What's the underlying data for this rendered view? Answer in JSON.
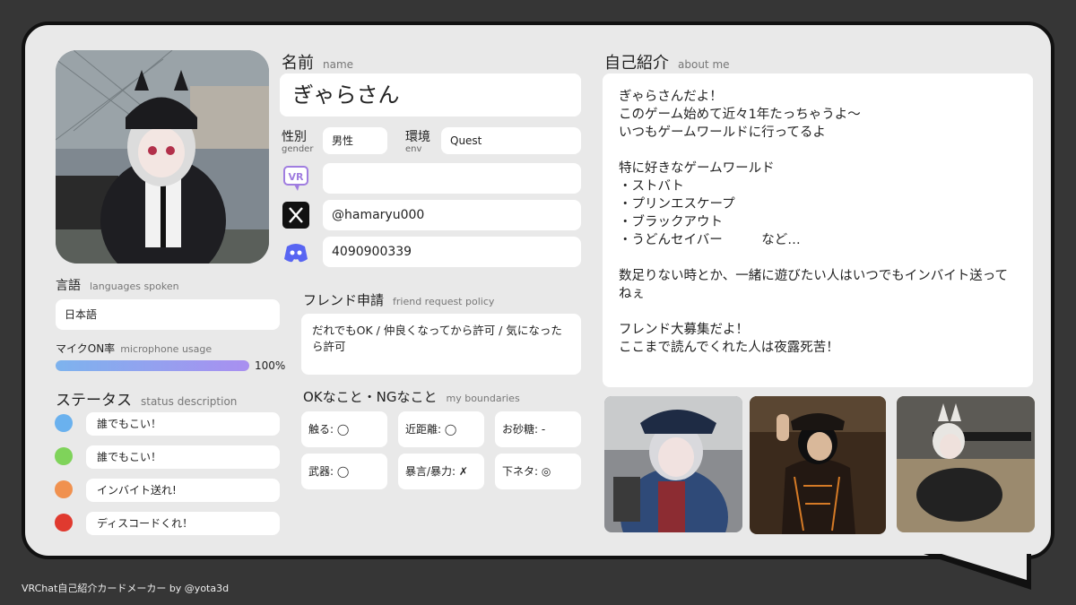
{
  "footer": "VRChat自己紹介カードメーカー by @yota3d",
  "name": {
    "title_jp": "名前",
    "title_en": "name",
    "value": "ぎゃらさん"
  },
  "gender": {
    "label_jp": "性別",
    "label_en": "gender",
    "value": "男性"
  },
  "env": {
    "label_jp": "環境",
    "label_en": "env",
    "value": "Quest"
  },
  "vr_field": {
    "icon": "vr-chat-icon",
    "value": ""
  },
  "x_field": {
    "icon": "x-logo-icon",
    "value": "@hamaryu000"
  },
  "discord_field": {
    "icon": "discord-icon",
    "value": "4090900339"
  },
  "language": {
    "title_jp": "言語",
    "title_en": "languages spoken",
    "value": "日本語"
  },
  "mic": {
    "title_jp": "マイクON率",
    "title_en": "microphone usage",
    "value": "100%",
    "fraction": 1.0
  },
  "status": {
    "title_jp": "ステータス",
    "title_en": "status description",
    "items": [
      {
        "color": "#6ab1ee",
        "text": "誰でもこい！"
      },
      {
        "color": "#7fd35a",
        "text": "誰でもこい！"
      },
      {
        "color": "#f0914f",
        "text": "インバイト送れ!"
      },
      {
        "color": "#e03a2f",
        "text": "ディスコードくれ！"
      }
    ]
  },
  "friend": {
    "title_jp": "フレンド申請",
    "title_en": "friend request policy",
    "value": "だれでもOK / 仲良くなってから許可 / 気になったら許可"
  },
  "boundaries": {
    "title_jp": "OKなこと・NGなこと",
    "title_en": "my boundaries",
    "items": [
      "触る: ◯",
      "近距離: ◯",
      "お砂糖: -",
      "武器: ◯",
      "暴言/暴力: ✗",
      "下ネタ: ◎"
    ]
  },
  "about": {
    "title_jp": "自己紹介",
    "title_en": "about me",
    "text": "ぎゃらさんだよ！\nこのゲーム始めて近々1年たっちゃうよ〜\nいつもゲームワールドに行ってるよ\n\n特に好きなゲームワールド\n・ストバト\n・プリンエスケープ\n・ブラックアウト\n・うどんセイバー　　　など…\n\n数足りない時とか、一緒に遊びたい人はいつでもインバイト送ってねぇ\n\nフレンド大募集だよ！\nここまで読んでくれた人は夜露死苦！"
  },
  "colors": {
    "accent_bar_start": "#7db3ee",
    "accent_bar_end": "#a98ff0",
    "discord": "#5865f2",
    "vr_icon": "#a07de0"
  }
}
